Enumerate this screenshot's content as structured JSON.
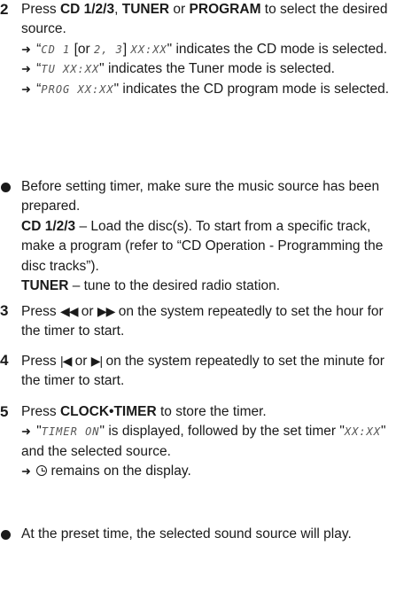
{
  "steps": {
    "s2": {
      "number": "2",
      "p1": "Press ",
      "cd": "CD 1/2/3",
      "p2": ", ",
      "tuner": "TUNER",
      "p3": " or ",
      "program": "PROGRAM",
      "p4": " to select the desired source.",
      "r1_lcd1": "CD 1",
      "r1_mid": " [or ",
      "r1_lcd2": "2, 3",
      "r1_mid2": "] ",
      "r1_lcd3": "XX:XX",
      "r1_tail": "\" indicates the CD mode is selected.",
      "r2_lcd": "TU XX:XX",
      "r2_tail": "\" indicates the Tuner mode is selected.",
      "r3_lcd": "PROG XX:XX",
      "r3_tail": "\" indicates the CD program mode is selected."
    },
    "bullet1": {
      "text": "Before setting timer, make sure the music source has been prepared.",
      "cd": "CD 1/2/3",
      "cd_text": " – Load the disc(s). To start from a specific track, make a program (refer to “CD Operation - Programming the disc tracks”).",
      "tuner": "TUNER",
      "tuner_text": " – tune to the desired radio station."
    },
    "s3": {
      "number": "3",
      "p1": "Press ",
      "p2": " or ",
      "p3": " on the system repeatedly to set the hour for the timer to start."
    },
    "s4": {
      "number": "4",
      "p1": "Press ",
      "p2": " or ",
      "p3": " on the system repeatedly to set the minute for the timer to start."
    },
    "s5": {
      "number": "5",
      "p1": "Press ",
      "clock": "CLOCK•TIMER",
      "p2": " to store the timer.",
      "r1_lcd": "TIMER ON",
      "r1_mid": "\" is displayed, followed by the set timer \"",
      "r1_lcd2": "XX:XX",
      "r1_tail": "\" and the selected source.",
      "r2_tail": " remains on the display."
    },
    "bullet2": {
      "text": "At the preset time, the selected sound source will play."
    }
  },
  "icons": {
    "result_arrow": "arrow-right-icon",
    "rewind": "rewind-icon",
    "fast_forward": "fast-forward-icon",
    "prev": "previous-track-icon",
    "next": "next-track-icon",
    "timer": "timer-icon"
  }
}
